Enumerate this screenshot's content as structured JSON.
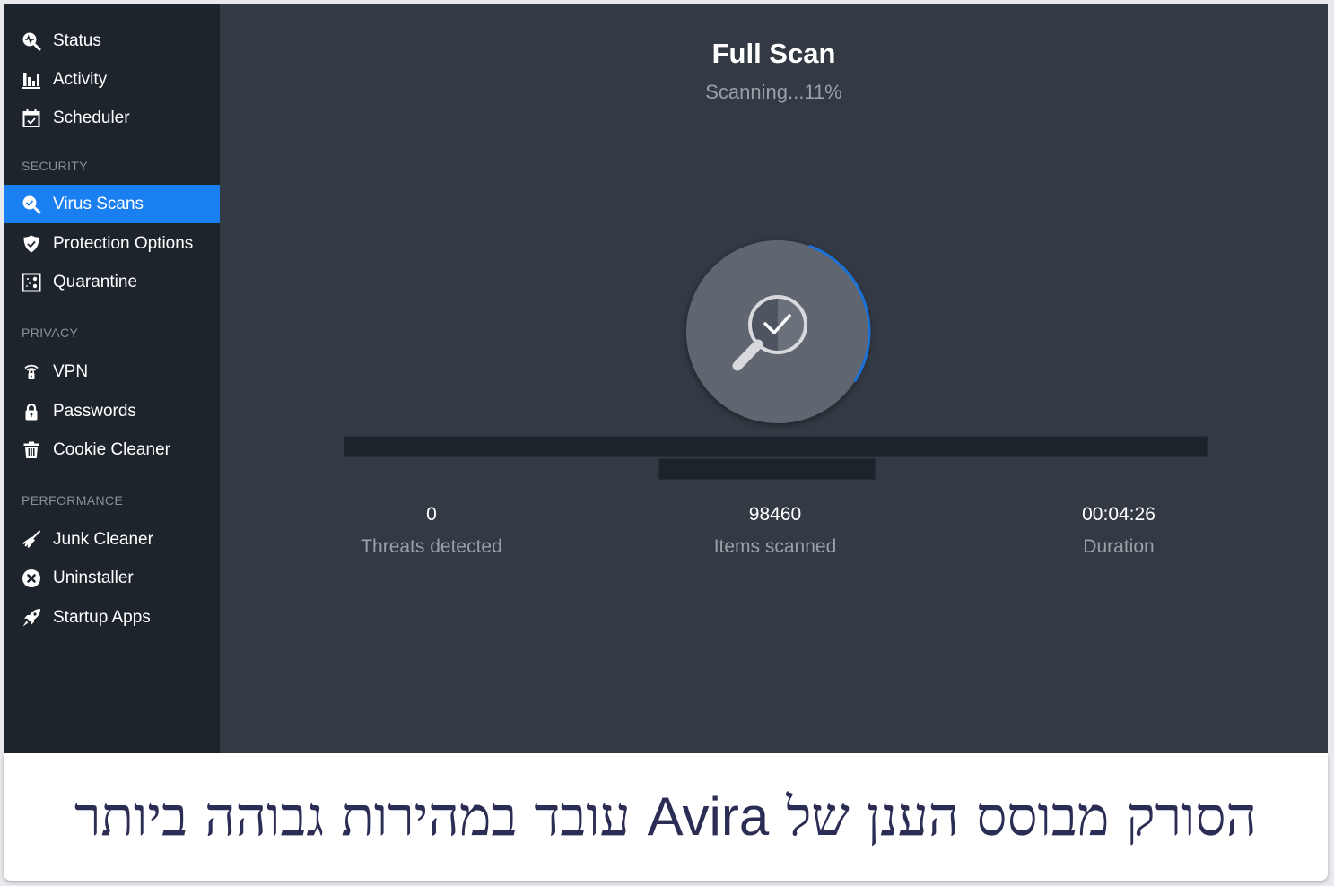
{
  "sidebar": {
    "top_items": [
      {
        "label": "Status",
        "icon": "status-magnifier-pulse-icon"
      },
      {
        "label": "Activity",
        "icon": "bar-chart-icon"
      },
      {
        "label": "Scheduler",
        "icon": "calendar-check-icon"
      }
    ],
    "sections": [
      {
        "title": "SECURITY",
        "items": [
          {
            "label": "Virus Scans",
            "icon": "magnifier-check-icon",
            "active": true
          },
          {
            "label": "Protection Options",
            "icon": "shield-check-icon"
          },
          {
            "label": "Quarantine",
            "icon": "quarantine-box-icon"
          }
        ]
      },
      {
        "title": "PRIVACY",
        "items": [
          {
            "label": "VPN",
            "icon": "wifi-lock-icon"
          },
          {
            "label": "Passwords",
            "icon": "padlock-icon"
          },
          {
            "label": "Cookie Cleaner",
            "icon": "trash-icon"
          }
        ]
      },
      {
        "title": "PERFORMANCE",
        "items": [
          {
            "label": "Junk Cleaner",
            "icon": "broom-icon"
          },
          {
            "label": "Uninstaller",
            "icon": "x-circle-icon"
          },
          {
            "label": "Startup Apps",
            "icon": "rocket-icon"
          }
        ]
      }
    ]
  },
  "main": {
    "title": "Full Scan",
    "status": "Scanning...11%",
    "progress_percent": 11,
    "stats": [
      {
        "value": "0",
        "label": "Threats detected"
      },
      {
        "value": "98460",
        "label": "Items scanned"
      },
      {
        "value": "00:04:26",
        "label": "Duration"
      }
    ]
  },
  "caption": {
    "before": "הסורק מבוסס הענן של ",
    "brand": "Avira",
    "after": " עובד במהירות גבוהה ביותר"
  },
  "colors": {
    "accent": "#1a7ff0",
    "sidebar_bg": "#1e242c",
    "main_bg": "#333a44",
    "caption_text": "#2b2d55"
  }
}
